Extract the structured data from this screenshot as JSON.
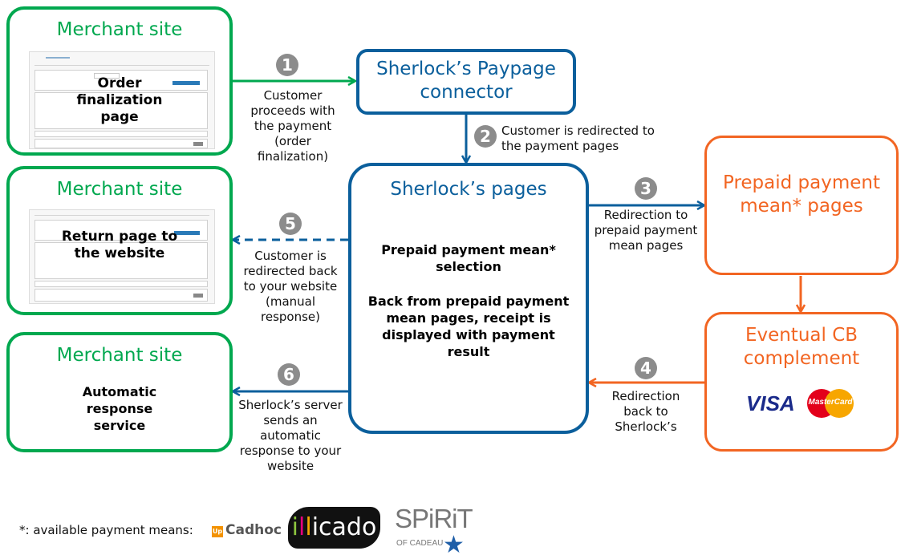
{
  "merchant_top": {
    "title": "Merchant site",
    "overlay": "Order finalization page"
  },
  "merchant_mid": {
    "title": "Merchant site",
    "overlay": "Return page to the website"
  },
  "merchant_bottom": {
    "title": "Merchant site",
    "body": "Automatic response service"
  },
  "connector": {
    "title": "Sherlock’s Paypage connector"
  },
  "sherlock_pages": {
    "title": "Sherlock’s pages",
    "text1": "Prepaid payment mean* selection",
    "text2": "Back from prepaid payment mean pages, receipt is displayed with payment result"
  },
  "prepaid_pages": {
    "title": "Prepaid payment mean* pages"
  },
  "cb_complement": {
    "title": "Eventual CB complement",
    "logos": [
      "VISA",
      "MasterCard"
    ]
  },
  "steps": [
    {
      "number": "1",
      "label": "Customer proceeds with the payment (order finalization)"
    },
    {
      "number": "2",
      "label": "Customer is redirected to the payment pages"
    },
    {
      "number": "3",
      "label": "Redirection to prepaid payment mean pages"
    },
    {
      "number": "4",
      "label": "Redirection back to Sherlock’s"
    },
    {
      "number": "5",
      "label": "Customer is redirected back to your website (manual response)"
    },
    {
      "number": "6",
      "label": "Sherlock’s server sends an automatic response to your website"
    }
  ],
  "footnote": {
    "text": "*: available payment means:",
    "brands": {
      "cadhoc_badge": "Up",
      "cadhoc": "Cadhoc",
      "illicado": [
        "i",
        "l",
        "l",
        "icado"
      ],
      "spirit": "SPiRiT",
      "spirit_sub": "OF CADEAU"
    }
  },
  "colors": {
    "merchant": "#00a84f",
    "sherlock": "#0b5f9c",
    "prepaid": "#f26522",
    "step_badge": "#8c8c8c"
  }
}
